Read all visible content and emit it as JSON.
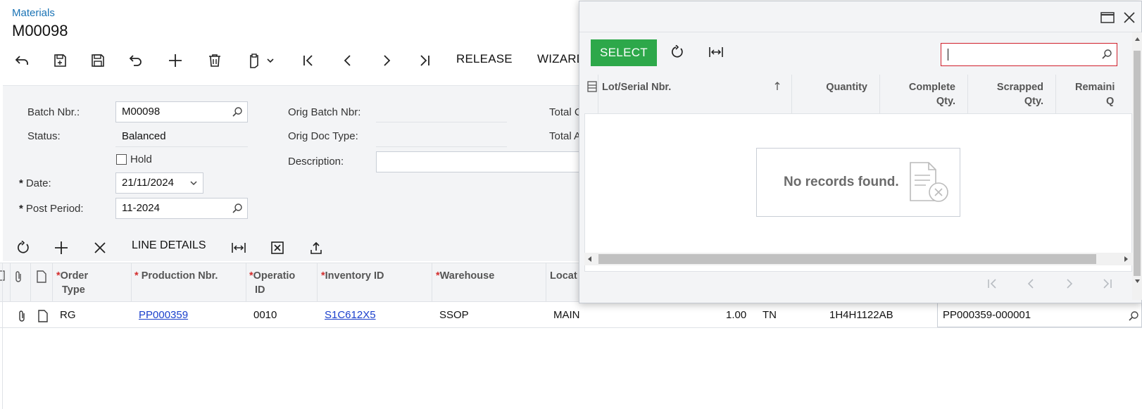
{
  "header": {
    "breadcrumb": "Materials",
    "title": "M00098"
  },
  "toolbar": {
    "release_label": "RELEASE",
    "wizard_label": "WIZARD"
  },
  "form": {
    "batch_nbr_label": "Batch Nbr.:",
    "batch_nbr_value": "M00098",
    "status_label": "Status:",
    "status_value": "Balanced",
    "hold_label": "Hold",
    "date_label": "Date:",
    "date_value": "21/11/2024",
    "post_period_label": "Post Period:",
    "post_period_value": "11-2024",
    "orig_batch_label": "Orig Batch Nbr:",
    "orig_doc_type_label": "Orig Doc Type:",
    "description_label": "Description:",
    "total_c_label": "Total C",
    "total_a_label": "Total A",
    "required_mark": "*"
  },
  "grid_toolbar": {
    "line_details_label": "LINE DETAILS"
  },
  "grid": {
    "columns": {
      "order_type_1": "Order",
      "order_type_2": "Type",
      "production_nbr": "Production Nbr.",
      "operation_1": "Operatio",
      "operation_2": "ID",
      "inventory_id": "Inventory ID",
      "warehouse": "Warehouse",
      "location": "Locat"
    },
    "row": {
      "order_type": "RG",
      "production_nbr": "PP000359",
      "operation_id": "0010",
      "inventory_id": "S1C612X5",
      "warehouse": "SSOP",
      "location": "MAIN",
      "quantity": "1.00",
      "uom": "TN",
      "lot_serial": "1H4H1122AB",
      "lot_field_value": "PP000359-000001"
    }
  },
  "dialog": {
    "select_label": "SELECT",
    "search_value": "",
    "columns": {
      "lot_serial": "Lot/Serial Nbr.",
      "quantity": "Quantity",
      "complete_1": "Complete",
      "complete_2": "Qty.",
      "scrapped_1": "Scrapped",
      "scrapped_2": "Qty.",
      "remaining_1": "Remaini",
      "remaining_2": "Q"
    },
    "no_records": "No records found."
  },
  "colors": {
    "accent_link": "#1a73b5",
    "select_button": "#2da84a",
    "search_border": "#d01f2b",
    "required_star": "#d32f2f"
  }
}
